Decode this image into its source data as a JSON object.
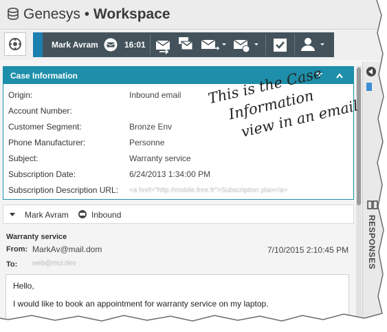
{
  "title_bar": {
    "brand": "Genesys",
    "separator": "•",
    "app_name": "Workspace"
  },
  "toolbar": {
    "agent_name": "Mark Avram",
    "time": "16:01",
    "icons": [
      "transfer-email-icon",
      "forward-email-icon",
      "reply-email-icon",
      "resend-email-icon",
      "mark-done-icon",
      "party-actions-icon"
    ]
  },
  "case_information": {
    "title": "Case Information",
    "add_symbol": "+",
    "collapse_symbol": "^",
    "fields": [
      {
        "label": "Origin:",
        "value": "Inbound email"
      },
      {
        "label": "Account Number:",
        "value": ""
      },
      {
        "label": "Customer Segment:",
        "value": "Bronze Env"
      },
      {
        "label": "Phone Manufacturer:",
        "value": "Personne"
      },
      {
        "label": "Subject:",
        "value": "Warranty service"
      },
      {
        "label": "Subscription Date:",
        "value": "6/24/2013 1:34:00 PM"
      },
      {
        "label": "Subscription Description URL:",
        "value": "<a href=\"http://mobile.free.fr\">Subscription plan</a>"
      }
    ]
  },
  "annotation": {
    "lines": [
      "This is the Case",
      "Information",
      "view in an email"
    ]
  },
  "interaction": {
    "agent": "Mark Avram",
    "status": "Inbound"
  },
  "email": {
    "subject": "Warranty service",
    "from_label": "From:",
    "from": "MarkAv@mail.dom",
    "date": "7/10/2015 2:10:45 PM",
    "to_label": "To:",
    "to": "web@mcr.dev",
    "body_lines": [
      "Hello,",
      "I would like to book an appointment for warranty service on my laptop."
    ]
  },
  "sidebar": {
    "responses_label": "RESPONSES"
  },
  "colors": {
    "header_teal": "#1e8faa",
    "toolbar_dark": "#44525b",
    "accent_blue": "#1d7fb0"
  }
}
